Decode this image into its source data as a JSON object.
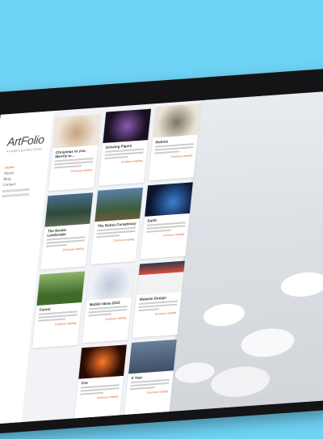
{
  "app": {
    "logo": "ArtFolio",
    "tagline": "A modern portfolio theme"
  },
  "nav": [
    "Home",
    "About",
    "Blog",
    "Contact"
  ],
  "cards": [
    {
      "title": "Christmas to you, Merrily to...",
      "more": "Continue reading"
    },
    {
      "title": "Glowing Figure",
      "more": "Continue reading"
    },
    {
      "title": "Robots",
      "more": "Continue reading"
    },
    {
      "title": "The Nordic Landscape",
      "more": "Continue reading"
    },
    {
      "title": "The Robot Conspiracy",
      "more": "Continue reading"
    },
    {
      "title": "Earth",
      "more": "Continue reading"
    },
    {
      "title": "Forest",
      "more": "Continue reading"
    },
    {
      "title": "Mobile Ideas 2012",
      "more": "Continue reading"
    },
    {
      "title": "Website Design",
      "more": "Continue reading"
    },
    {
      "title": "Fire",
      "more": "Continue reading"
    },
    {
      "title": "A Year",
      "more": "Continue reading"
    }
  ],
  "colors": {
    "accent": "#e2632b",
    "background": "#6fd3f5",
    "tablet": "#141416"
  }
}
